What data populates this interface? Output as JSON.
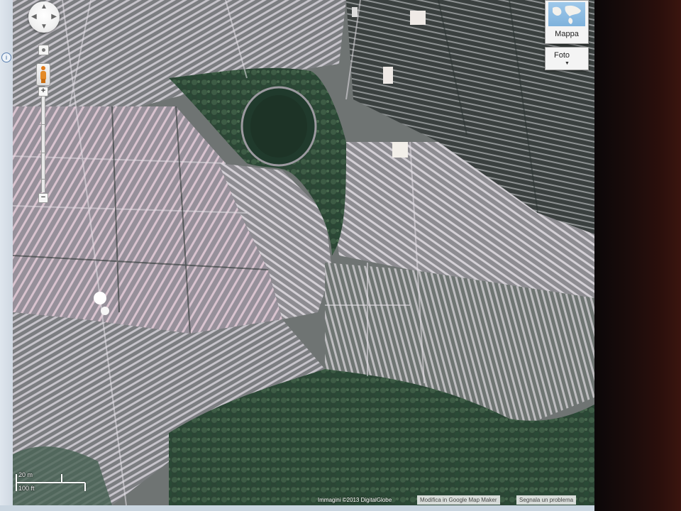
{
  "map": {
    "view_mode": "satellite",
    "controls": {
      "pan_icon": "pan-arrows-icon",
      "zoom_in_label": "+",
      "zoom_out_label": "−",
      "streetview_icon": "pegman-icon",
      "zoom_reset_icon": "zoom-reset-icon"
    },
    "map_types": {
      "map_label": "Mappa",
      "photo_label": "Foto",
      "photo_caret": "▼"
    },
    "scale": {
      "metric": "20 m",
      "imperial": "100 ft"
    },
    "attribution": {
      "imagery": "Immagini ©2013 DigitalGlobe",
      "edit_link": "Modifica in Google Map Maker",
      "report_link": "Segnala un problema"
    },
    "colors": {
      "vegetation": "#2f4a38",
      "field_light": "#b7b3b8",
      "field_dark": "#4b5150",
      "pink_tint": "#c79aa9",
      "bezel": "#1a0c0b"
    }
  }
}
